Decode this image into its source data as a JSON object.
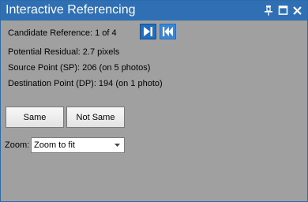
{
  "window": {
    "title": "Interactive Referencing",
    "controls": [
      "pin-icon",
      "restore-icon",
      "close-icon"
    ]
  },
  "candidate": {
    "label": "Candidate Reference: 1 of 4",
    "next_icon": "next-icon",
    "first_icon": "first-icon"
  },
  "info": {
    "residual": "Potential Residual: 2.7 pixels",
    "source_point": "Source Point (SP): 206 (on 5 photos)",
    "destination_point": "Destination Point (DP): 194 (on 1 photo)"
  },
  "buttons": {
    "same": "Same",
    "not_same": "Not Same"
  },
  "zoom": {
    "label": "Zoom:",
    "value": "Zoom to fit"
  },
  "colors": {
    "titlebar": "#2f6fb3",
    "panel": "#a0a0a0",
    "nav_button": "#1e6fc4"
  }
}
